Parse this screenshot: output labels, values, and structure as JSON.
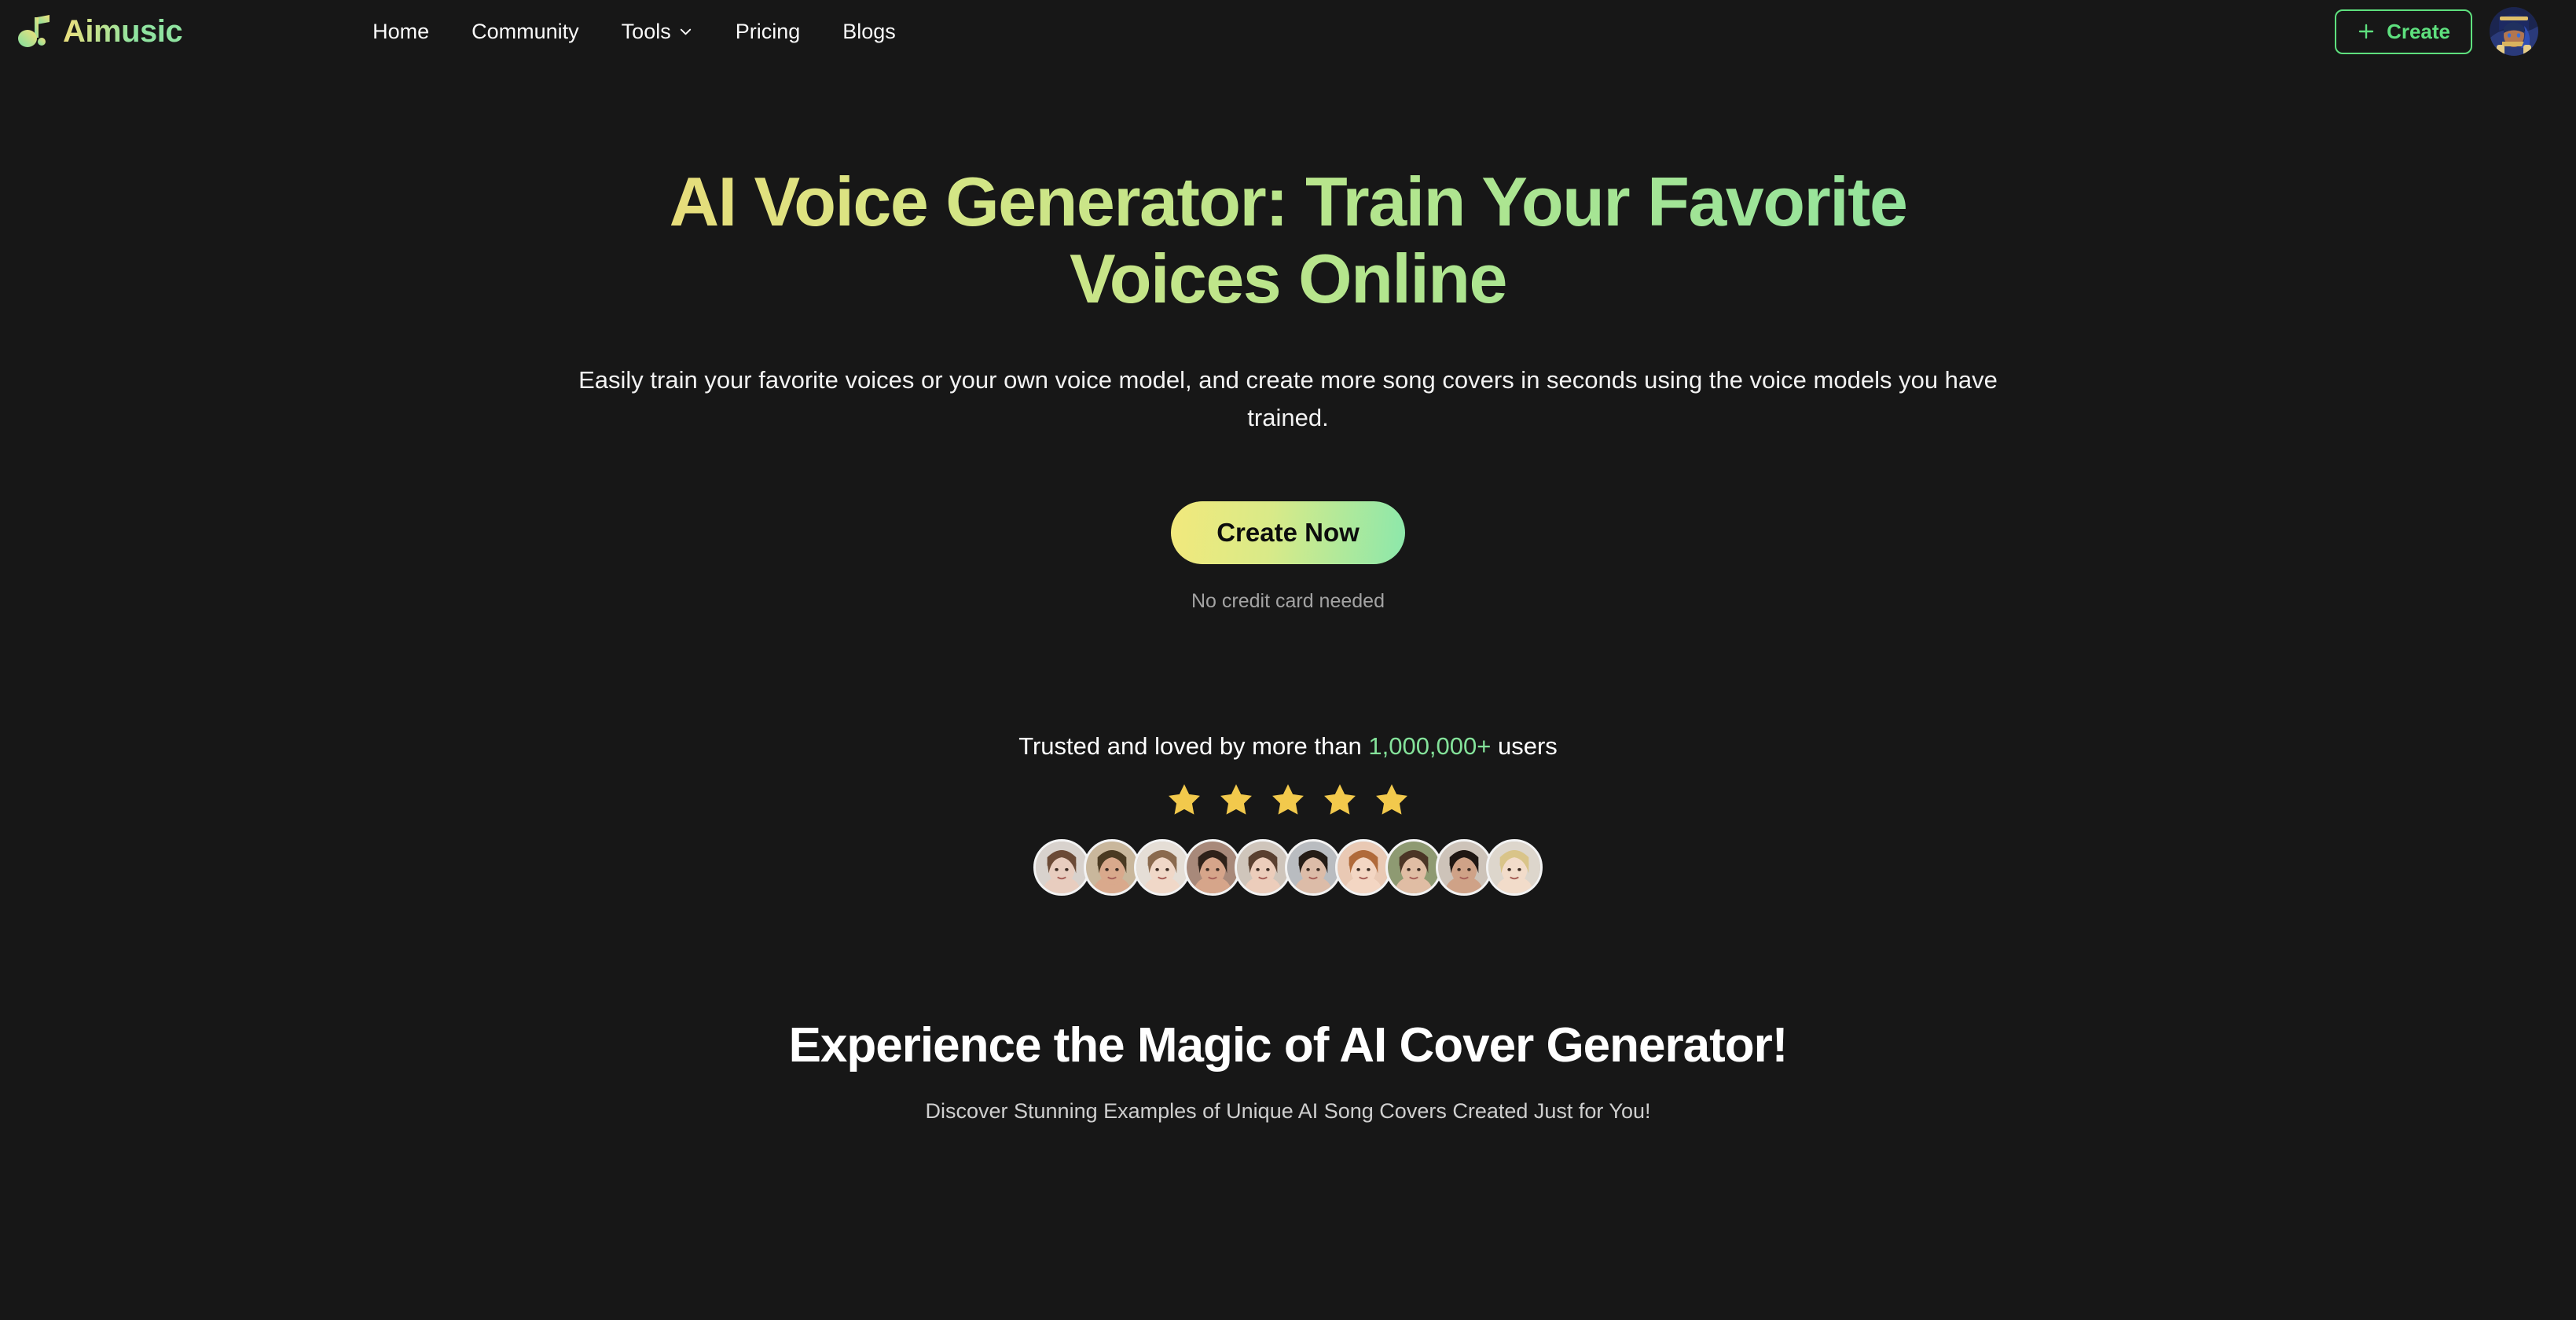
{
  "theme": {
    "background": "#171717",
    "accent_green": "#5ee07e",
    "accent_mint": "#8ee49f",
    "accent_yellow": "#ecd977",
    "star_color": "#f2c94c",
    "muted_text": "#a3a3a3"
  },
  "header": {
    "brand": {
      "name": "Aimusic",
      "logo_icon": "music-note-icon"
    },
    "nav": [
      {
        "label": "Home",
        "has_dropdown": false
      },
      {
        "label": "Community",
        "has_dropdown": false
      },
      {
        "label": "Tools",
        "has_dropdown": true,
        "dropdown_icon": "chevron-down-icon"
      },
      {
        "label": "Pricing",
        "has_dropdown": false
      },
      {
        "label": "Blogs",
        "has_dropdown": false
      }
    ],
    "create_button": {
      "label": "Create",
      "icon": "plus-icon"
    },
    "user_avatar": {
      "icon": "user-avatar-icon",
      "alt": "User profile"
    }
  },
  "hero": {
    "title": "AI Voice Generator: Train Your Favorite Voices Online",
    "subtitle": "Easily train your favorite voices or your own voice model, and create more song covers in seconds using the voice models you have trained.",
    "cta_label": "Create Now",
    "cta_note": "No credit card needed"
  },
  "trust": {
    "prefix": "Trusted and loved by more than ",
    "count": "1,000,000+",
    "suffix": " users",
    "star_count": 5,
    "stars": [
      "star-icon",
      "star-icon",
      "star-icon",
      "star-icon",
      "star-icon"
    ],
    "avatars": [
      {
        "icon": "user-photo-icon",
        "skin": "#e8cdbf",
        "hair": "#6b4a36",
        "bg": "#d8d2cd"
      },
      {
        "icon": "user-photo-icon",
        "skin": "#d9a98c",
        "hair": "#4a3a22",
        "bg": "#c9b79c"
      },
      {
        "icon": "user-photo-icon",
        "skin": "#f0d8c8",
        "hair": "#8a6a4e",
        "bg": "#e5ded6"
      },
      {
        "icon": "user-photo-icon",
        "skin": "#d6a58a",
        "hair": "#2e2119",
        "bg": "#a8897a"
      },
      {
        "icon": "user-photo-icon",
        "skin": "#eccdbb",
        "hair": "#5a4030",
        "bg": "#cfc5bb"
      },
      {
        "icon": "user-photo-icon",
        "skin": "#dcbca8",
        "hair": "#241c16",
        "bg": "#b9bcc0"
      },
      {
        "icon": "user-photo-icon",
        "skin": "#f3d6c3",
        "hair": "#b06a3a",
        "bg": "#e9c9b4"
      },
      {
        "icon": "user-photo-icon",
        "skin": "#e0bda4",
        "hair": "#4b3526",
        "bg": "#8e9a72"
      },
      {
        "icon": "user-photo-icon",
        "skin": "#cfa287",
        "hair": "#1f1713",
        "bg": "#cdc3b9"
      },
      {
        "icon": "user-photo-icon",
        "skin": "#f2dcca",
        "hair": "#d9c489",
        "bg": "#ddd6cc"
      }
    ]
  },
  "section": {
    "title": "Experience the Magic of AI Cover Generator!",
    "subtitle": "Discover Stunning Examples of Unique AI Song Covers Created Just for You!"
  }
}
